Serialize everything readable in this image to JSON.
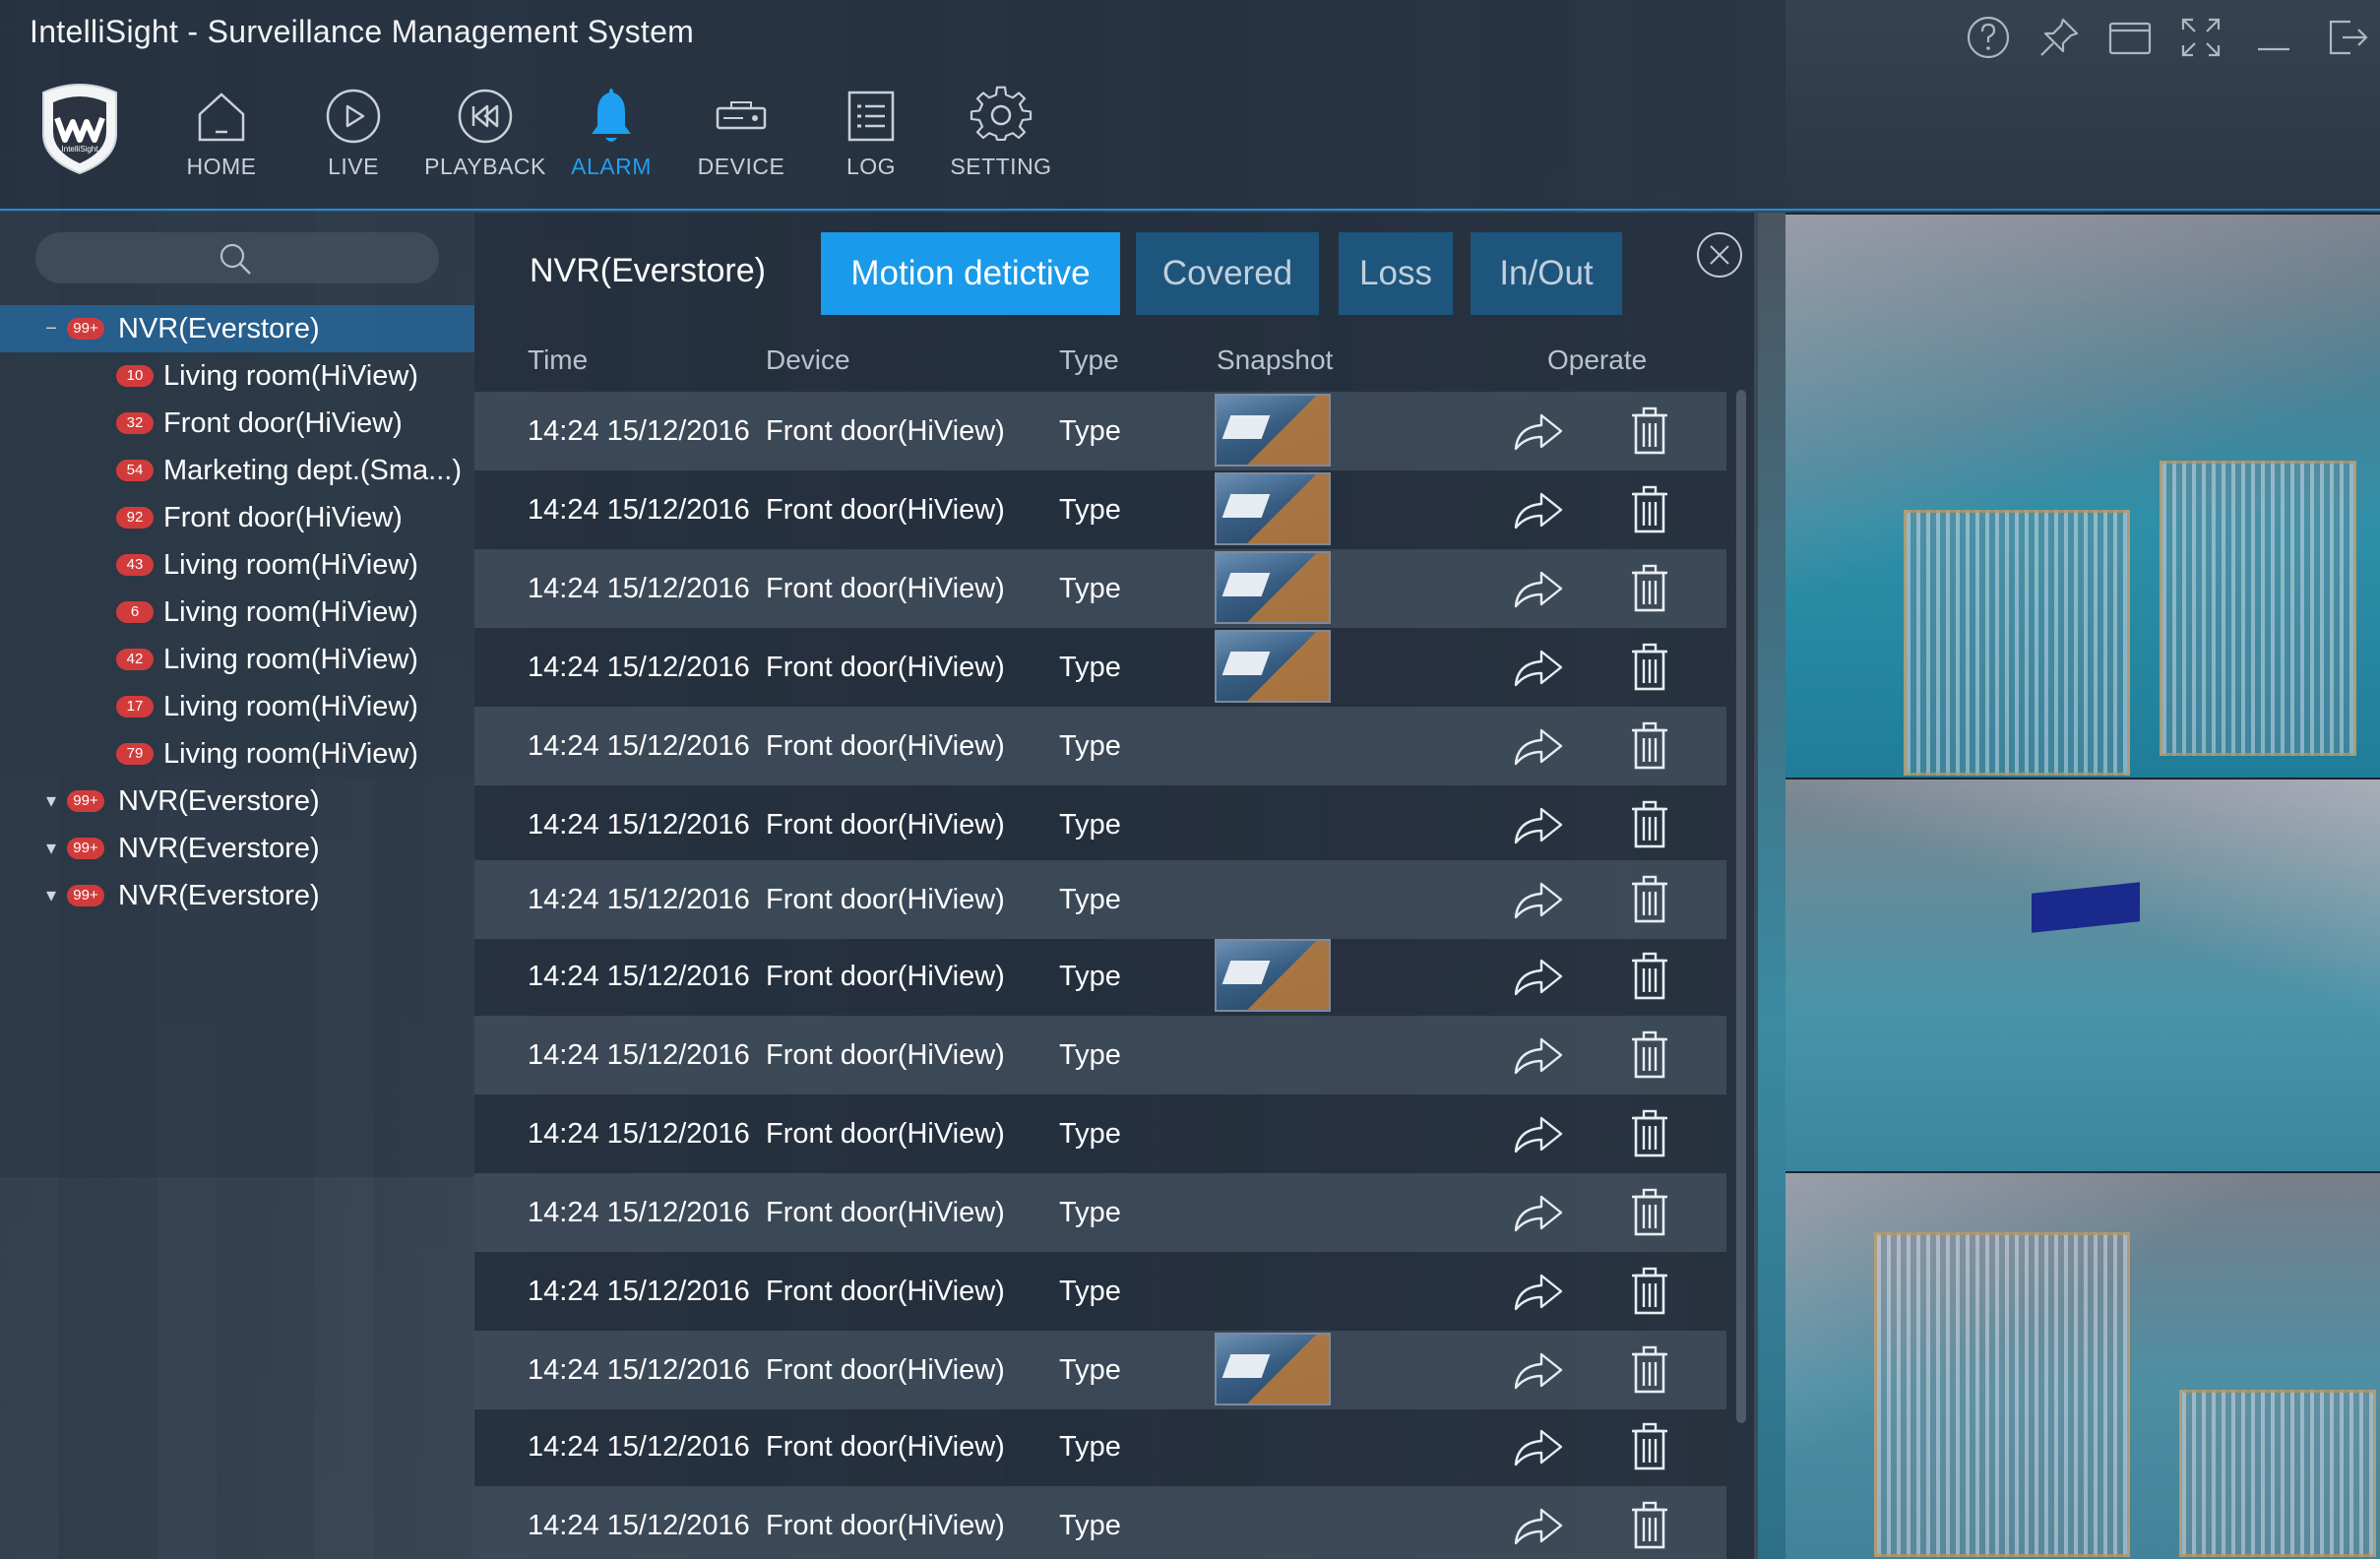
{
  "app": {
    "title": "IntelliSight - Surveillance Management System",
    "logo_text": "IntelliSight"
  },
  "nav": [
    {
      "label": "HOME",
      "icon": "home-icon",
      "active": false
    },
    {
      "label": "LIVE",
      "icon": "play-icon",
      "active": false
    },
    {
      "label": "PLAYBACK",
      "icon": "rewind-icon",
      "active": false
    },
    {
      "label": "ALARM",
      "icon": "bell-icon",
      "active": true
    },
    {
      "label": "DEVICE",
      "icon": "device-icon",
      "active": false
    },
    {
      "label": "LOG",
      "icon": "list-icon",
      "active": false
    },
    {
      "label": "SETTING",
      "icon": "gear-icon",
      "active": false
    }
  ],
  "window_controls": [
    "help-icon",
    "pin-icon",
    "window-icon",
    "fullscreen-icon",
    "minimize-icon",
    "logout-icon"
  ],
  "sidebar": {
    "tree": [
      {
        "label": "NVR(Everstore)",
        "badge": "99+",
        "expanded": true,
        "selected": true,
        "children": [
          {
            "label": "Living room(HiView)",
            "badge": "10"
          },
          {
            "label": "Front door(HiView)",
            "badge": "32"
          },
          {
            "label": "Marketing dept.(Sma...)",
            "badge": "54"
          },
          {
            "label": "Front door(HiView)",
            "badge": "92"
          },
          {
            "label": "Living room(HiView)",
            "badge": "43"
          },
          {
            "label": "Living room(HiView)",
            "badge": "6"
          },
          {
            "label": "Living room(HiView)",
            "badge": "42"
          },
          {
            "label": "Living room(HiView)",
            "badge": "17"
          },
          {
            "label": "Living room(HiView)",
            "badge": "79"
          }
        ]
      },
      {
        "label": "NVR(Everstore)",
        "badge": "99+",
        "expanded": false
      },
      {
        "label": "NVR(Everstore)",
        "badge": "99+",
        "expanded": false
      },
      {
        "label": "NVR(Everstore)",
        "badge": "99+",
        "expanded": false
      }
    ]
  },
  "alarm_panel": {
    "title": "NVR(Everstore)",
    "tabs": [
      {
        "label": "Motion detictive",
        "active": true
      },
      {
        "label": "Covered",
        "active": false
      },
      {
        "label": "Loss",
        "active": false
      },
      {
        "label": "In/Out",
        "active": false
      }
    ],
    "columns": [
      "Time",
      "Device",
      "Type",
      "Snapshot",
      "Operate"
    ],
    "rows": [
      {
        "time": "14:24 15/12/2016",
        "device": "Front door(HiView)",
        "type": "Type",
        "snapshot": true
      },
      {
        "time": "14:24 15/12/2016",
        "device": "Front door(HiView)",
        "type": "Type",
        "snapshot": true
      },
      {
        "time": "14:24 15/12/2016",
        "device": "Front door(HiView)",
        "type": "Type",
        "snapshot": true
      },
      {
        "time": "14:24 15/12/2016",
        "device": "Front door(HiView)",
        "type": "Type",
        "snapshot": true
      },
      {
        "time": "14:24 15/12/2016",
        "device": "Front door(HiView)",
        "type": "Type",
        "snapshot": false
      },
      {
        "time": "14:24 15/12/2016",
        "device": "Front door(HiView)",
        "type": "Type",
        "snapshot": false
      },
      {
        "time": "14:24 15/12/2016",
        "device": "Front door(HiView)",
        "type": "Type",
        "snapshot": false
      },
      {
        "time": "14:24 15/12/2016",
        "device": "Front door(HiView)",
        "type": "Type",
        "snapshot": true
      },
      {
        "time": "14:24 15/12/2016",
        "device": "Front door(HiView)",
        "type": "Type",
        "snapshot": false
      },
      {
        "time": "14:24 15/12/2016",
        "device": "Front door(HiView)",
        "type": "Type",
        "snapshot": false
      },
      {
        "time": "14:24 15/12/2016",
        "device": "Front door(HiView)",
        "type": "Type",
        "snapshot": false
      },
      {
        "time": "14:24 15/12/2016",
        "device": "Front door(HiView)",
        "type": "Type",
        "snapshot": false
      },
      {
        "time": "14:24 15/12/2016",
        "device": "Front door(HiView)",
        "type": "Type",
        "snapshot": true
      },
      {
        "time": "14:24 15/12/2016",
        "device": "Front door(HiView)",
        "type": "Type",
        "snapshot": false
      },
      {
        "time": "14:24 15/12/2016",
        "device": "Front door(HiView)",
        "type": "Type",
        "snapshot": false
      }
    ]
  },
  "colors": {
    "accent": "#1a9aea",
    "badge": "#d23b3b",
    "selected_row": "#246eaa"
  }
}
